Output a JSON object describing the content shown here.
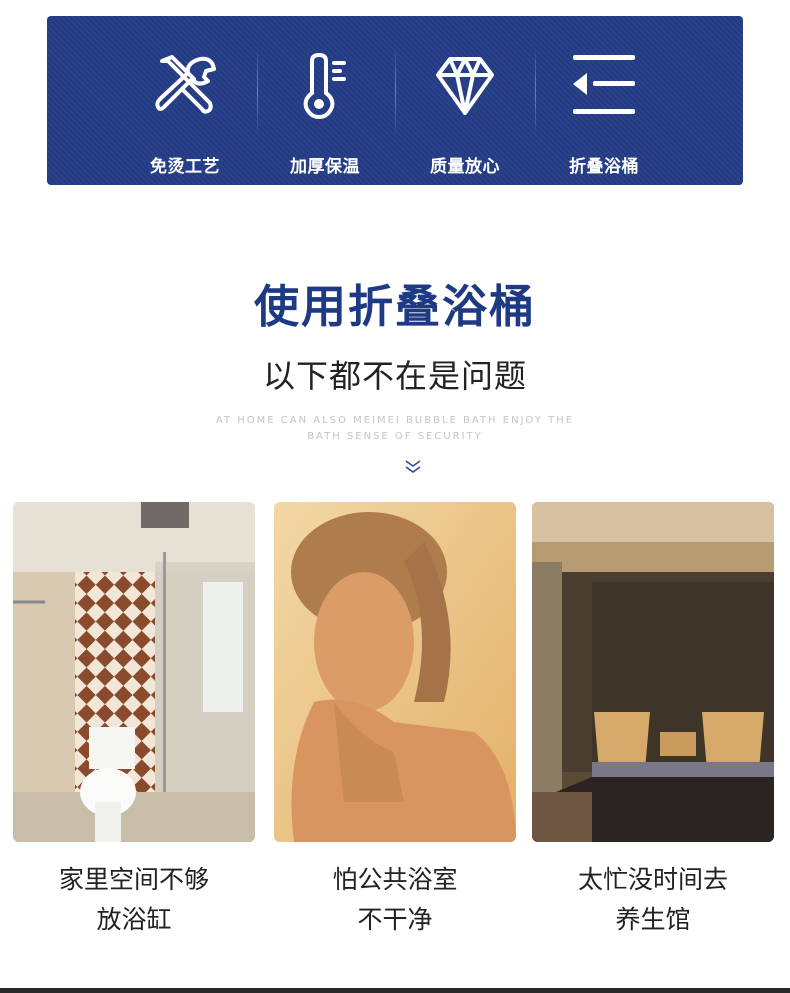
{
  "features": [
    {
      "label": "免烫工艺",
      "icon": "tools-icon"
    },
    {
      "label": "加厚保温",
      "icon": "thermometer-icon"
    },
    {
      "label": "质量放心",
      "icon": "diamond-icon"
    },
    {
      "label": "折叠浴桶",
      "icon": "fold-icon"
    }
  ],
  "heading": {
    "title": "使用折叠浴桶",
    "subtitle": "以下都不在是问题",
    "english": "AT HOME CAN ALSO MEIMEI BUBBLE BATH ENJOY THE BATH SENSE OF SECURITY"
  },
  "cards": [
    {
      "line1": "家里空间不够",
      "line2": "放浴缸"
    },
    {
      "line1": "怕公共浴室",
      "line2": "不干净"
    },
    {
      "line1": "太忙没时间去",
      "line2": "养生馆"
    }
  ],
  "colors": {
    "banner": "#243d86",
    "title": "#1f3a85"
  }
}
